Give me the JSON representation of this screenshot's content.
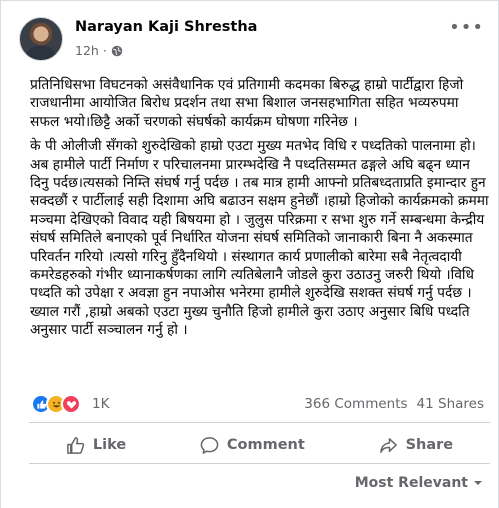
{
  "post": {
    "author": "Narayan Kaji Shrestha",
    "time": "12h",
    "paragraphs": [
      "प्रतिनिधिसभा विघटनको असंवैधानिक एवं  प्रतिगामी कदमका बिरुद्ध हाम्रो पार्टीद्वारा  हिजो राजधानीमा आयोजित बिरोध प्रदर्शन तथा सभा बिशाल जनसहभागिता सहित भव्यरुपमा सफल भयो।छिट्टै अर्को चरणको संघर्षको कार्यक्रम घोषणा गरिनेछ ।",
      " के पी ओलीजी  सँगको शुरुदेखिको हाम्रो एउटा मुख्य मतभेद विधि र पध्दतिको पालनामा हो।अब हामीले पार्टी निर्माण र परिचालनमा प्रारम्भदेखि नै पध्दतिसम्मत ढङ्गले अघि बढ्न ध्यान दिनु पर्दछ।त्यसको निम्ति संघर्ष गर्नु पर्दछ । तब मात्र हामी आफ्नो प्रतिबध्दताप्रति इमान्दार हुन  सक्दछौं र  पार्टीलाई सही दिशामा अघि बढाउन सक्षम हुनेछौं ।हाम्रो हिजोको कार्यक्रमको क्रममा मञ्चमा देखिएको विवाद यही बिषयमा हो । जुलुस परिक्रमा र सभा शुरु गर्ने सम्बन्धमा केन्द्रीय संघर्ष समितिले बनाएको पूर्व निर्धारित योजना संघर्ष समितिको जानाकारी बिना नै अकस्मात परिवर्तन गरियो ।त्यसो गरिनु हुँदैनथियो । संस्थागत कार्य प्रणालीको बारेमा  सबै नेतृत्वदायी कमरेडहरुको गंभीर ध्यानाकर्षणका लागि त्यतिबेलानै जोडले कुरा उठाउनु  जरुरी थियो ।विधि पध्दति को उपेक्षा र अवज्ञा हुन नपाओस भनेरमा हामीले शुरुदेखि सशक्त संघर्ष गर्नु पर्दछ ।ख्याल गरौं ,हाम्रो अबको एउटा मुख्य चुनौति हिजो हामीले कुरा उठाए अनुसार बिधि पध्दति अनुसार पार्टी सञ्चालन गर्नु हो ।"
    ]
  },
  "reactions": {
    "icons": [
      "like-icon",
      "haha-icon",
      "love-icon"
    ],
    "count": "1K",
    "comments": "366 Comments",
    "shares": "41 Shares"
  },
  "actions": {
    "like": "Like",
    "comment": "Comment",
    "share": "Share"
  },
  "sort": {
    "label": "Most Relevant"
  },
  "colors": {
    "secondary_text": "#65676b",
    "like_blue": "#1877f2",
    "divider": "#ced0d4"
  }
}
